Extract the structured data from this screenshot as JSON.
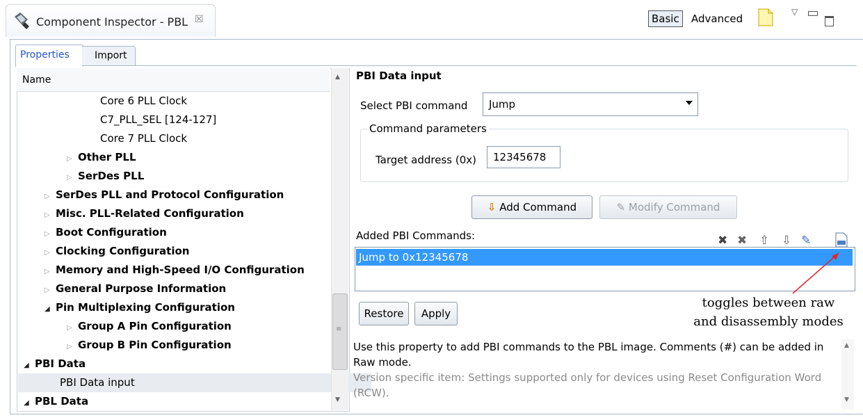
{
  "window": {
    "title": "Component Inspector - PBL",
    "close_glyph": "☒",
    "modes": {
      "basic": "Basic",
      "advanced": "Advanced"
    },
    "icons": [
      "inspector-icon",
      "note-icon",
      "view-menu-icon",
      "minimize-icon",
      "maximize-icon"
    ]
  },
  "tabs": {
    "properties": "Properties",
    "import": "Import"
  },
  "tree": {
    "header": "Name",
    "rows": [
      {
        "label": "Core 6 PLL Clock",
        "bold": false,
        "twisty": ""
      },
      {
        "label": "C7_PLL_SEL  [124-127]",
        "bold": false,
        "twisty": ""
      },
      {
        "label": "Core 7 PLL Clock",
        "bold": false,
        "twisty": ""
      },
      {
        "label": "Other PLL",
        "bold": true,
        "twisty": "closed"
      },
      {
        "label": "SerDes PLL",
        "bold": true,
        "twisty": "closed"
      },
      {
        "label": "SerDes PLL and Protocol Configuration",
        "bold": true,
        "twisty": "closed"
      },
      {
        "label": "Misc. PLL-Related Configuration",
        "bold": true,
        "twisty": "closed"
      },
      {
        "label": "Boot Configuration",
        "bold": true,
        "twisty": "closed"
      },
      {
        "label": "Clocking Configuration",
        "bold": true,
        "twisty": "closed"
      },
      {
        "label": "Memory and High-Speed I/O Configuration",
        "bold": true,
        "twisty": "closed"
      },
      {
        "label": "General Purpose Information",
        "bold": true,
        "twisty": "closed"
      },
      {
        "label": "Pin Multiplexing Configuration",
        "bold": true,
        "twisty": "open"
      },
      {
        "label": "Group A Pin Configuration",
        "bold": true,
        "twisty": "closed"
      },
      {
        "label": "Group B Pin Configuration",
        "bold": true,
        "twisty": "closed"
      },
      {
        "label": "PBI Data",
        "bold": true,
        "twisty": "open"
      },
      {
        "label": "PBI Data input",
        "bold": false,
        "twisty": "",
        "selected": true
      },
      {
        "label": "PBL Data",
        "bold": true,
        "twisty": "open"
      }
    ]
  },
  "pbi": {
    "heading": "PBI Data input",
    "select_label": "Select PBI command",
    "select_value": "Jump",
    "params_title": "Command parameters",
    "target_label": "Target address (0x)",
    "target_value": "12345678",
    "add_button": "Add Command",
    "modify_button": "Modify Command",
    "added_label": "Added PBI Commands:",
    "commands": [
      "Jump to 0x12345678"
    ],
    "toolbar_icons": [
      "delete-icon",
      "delete-all-icon",
      "move-up-icon",
      "move-down-icon",
      "edit-icon",
      "raw-toggle-icon"
    ],
    "restore_button": "Restore",
    "apply_button": "Apply",
    "annotation_line1": "toggles between raw",
    "annotation_line2": "and disassembly modes",
    "annotation_color": "#e0282e",
    "description": "Use this property to add PBI commands to the PBL image. Comments (#) can be added in Raw mode.",
    "version_note": "Version specific item: Settings supported only for devices using Reset Configuration Word (RCW)."
  },
  "colors": {
    "selection": "#3399ff",
    "tab_active_text": "#2a56c6"
  }
}
